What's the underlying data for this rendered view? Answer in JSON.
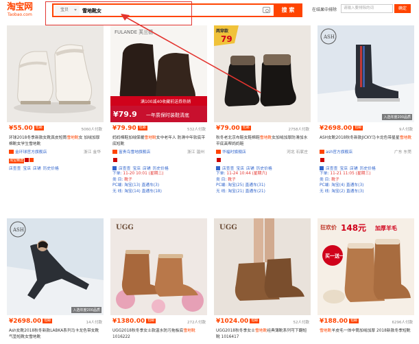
{
  "header": {
    "logo_cn": "淘宝网",
    "logo_en": "Taobao.com",
    "search_type": "宝贝",
    "search_query": "雪地靴女",
    "search_button": "搜 索",
    "in_result_label": "在结果中排除",
    "in_result_placeholder": "请输入要排除的词",
    "confirm_button": "确定"
  },
  "colors": {
    "accent": "#ff4400",
    "link": "#3366cc",
    "highlight_box": "#e3342f"
  },
  "icons": [
    "camera-icon",
    "shop-icon"
  ],
  "products": [
    {
      "price": "¥55.00",
      "baoyou": "包邮",
      "sales": "5060人付款",
      "title_a": "环球2018冬季新款女靴真皮短筒",
      "title_hl": "雪地靴",
      "title_b": "女 加绒加厚棉靴女学生雪地靴",
      "shop": "金环球官方旗舰店",
      "location": "浙江 金华",
      "badge": "淘宝精选",
      "image_watermark": ""
    },
    {
      "price": "¥79.90",
      "baoyou": "包邮",
      "sales": "532人付款",
      "title_a": "妈妈棉鞋加绒保暖",
      "title_hl": "雪地靴",
      "title_b": "女中老年人 防滑中年软底平底短靴",
      "shop": "富贵鸟雪地旗舰店",
      "location": "浙江 温州",
      "overlay_text": "满100减40收藏前送券热销",
      "overlay_price": "¥79.9",
      "overlay_sub": "一年质保时装鞋清底",
      "brand": "FULANDE 芙兰德",
      "order_label": "下单:",
      "order_value": "11-20 10:01 (星期二)",
      "type_label": "类 目:",
      "type_value": "靴子",
      "pc_label": "PC端:",
      "pc_value": "淘宝(13) 直通车(3)",
      "mobile_label": "无 线:",
      "mobile_value": "淘宝(14) 直通车(18)"
    },
    {
      "price": "¥79.00",
      "baoyou": "包邮",
      "sales": "2758人付款",
      "title_a": "秋冬老北京布鞋女鞋棉鞋",
      "title_hl": "雪地靴",
      "title_b": "女加绒加厚防滑加水平底高帮妈妈鞋",
      "shop": "华福时旗舰店",
      "location": "河北 石家庄",
      "overlay_price": "79",
      "overlay_badge": "两穿款",
      "order_label": "下单:",
      "order_value": "11-24 10:44 (星期六)",
      "type_label": "类 目:",
      "type_value": "靴子",
      "pc_label": "PC端:",
      "pc_value": "淘宝(25) 直通车(31)",
      "mobile_label": "无 线:",
      "mobile_value": "淘宝(21) 直通车(21)"
    },
    {
      "price": "¥2698.00",
      "baoyou": "包邮",
      "sales": "9人付款",
      "title_a": "ASH女靴2018秋冬新款JICKY马卡龙色带星星",
      "title_hl": "雪地靴",
      "title_b": "",
      "shop": "ash官方旗舰店",
      "location": "广东 东莞",
      "order_label": "下单:",
      "order_value": "11-21 11:05 (星期三)",
      "type_label": "类 目:",
      "type_value": "靴子",
      "pc_label": "PC端:",
      "pc_value": "淘宝(4) 直通车(3)",
      "mobile_label": "无 线:",
      "mobile_value": "淘宝(2) 直通车(3)",
      "image_watermark": "入选年度200品质"
    },
    {
      "price": "¥2698.00",
      "baoyou": "包邮",
      "sales": "14人付款",
      "title_a": "Ash女靴2018秋冬新款LABKA系列马卡龙色带",
      "title_hl": "",
      "title_b": "女靴气垫短靴女雪地靴",
      "image_watermark": "入选年度200品质"
    },
    {
      "price": "¥1380.00",
      "baoyou": "包邮",
      "sales": "272人付款",
      "title_a": "UGG2018秋冬季女士款温水防污拖板底",
      "title_hl": "雪地靴",
      "title_b": " 1016222"
    },
    {
      "price": "¥1024.00",
      "baoyou": "包邮",
      "sales": "52人付款",
      "title_a": "UGG2018秋冬季女士",
      "title_hl": "雪地靴",
      "title_b": "经典薄靴系列可下翻短靴 1016417"
    },
    {
      "price": "¥188.00",
      "baoyou": "包邮",
      "sales": "6296人付款",
      "title_a": "",
      "title_hl": "雪地靴",
      "title_b": "羊皮毛一体中筒加绒加厚 2018新款冬季短靴",
      "overlay_main": "狂欢价",
      "overlay_price": "148元",
      "overlay_rest": "加厚羊毛",
      "overlay_circle": "买一送一"
    }
  ],
  "links": [
    "店查查",
    "宝店",
    "店铺",
    "历史价格"
  ]
}
